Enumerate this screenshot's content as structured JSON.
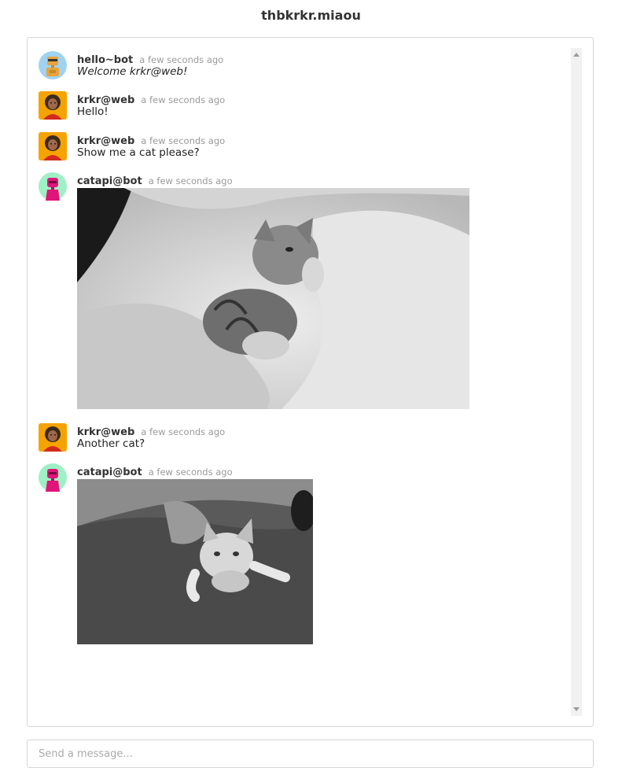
{
  "room": {
    "title": "thbkrkr.miaou"
  },
  "messages": [
    {
      "author": "hello~bot",
      "time": "a few seconds ago",
      "text": "Welcome krkr@web!",
      "avatar": "robot-avatar-yellow"
    },
    {
      "author": "krkr@web",
      "time": "a few seconds ago",
      "text": "Hello!",
      "avatar": "person-avatar"
    },
    {
      "author": "krkr@web",
      "time": "a few seconds ago",
      "text": "Show me a cat please?",
      "avatar": "person-avatar"
    },
    {
      "author": "catapi@bot",
      "time": "a few seconds ago",
      "image": "kitten-photo-1",
      "avatar": "robot-avatar-pink"
    },
    {
      "author": "krkr@web",
      "time": "a few seconds ago",
      "text": "Another cat?",
      "avatar": "person-avatar"
    },
    {
      "author": "catapi@bot",
      "time": "a few seconds ago",
      "image": "kitten-photo-2",
      "avatar": "robot-avatar-pink"
    }
  ],
  "composer": {
    "placeholder": "Send a message..."
  },
  "colors": {
    "accent_bot_yellow": "#e8a33a",
    "accent_bot_pink": "#e0157a",
    "avatar_bg_blue": "#9fd3f0",
    "avatar_bg_orange": "#f5a300",
    "avatar_bg_green": "#9ff0c4"
  }
}
